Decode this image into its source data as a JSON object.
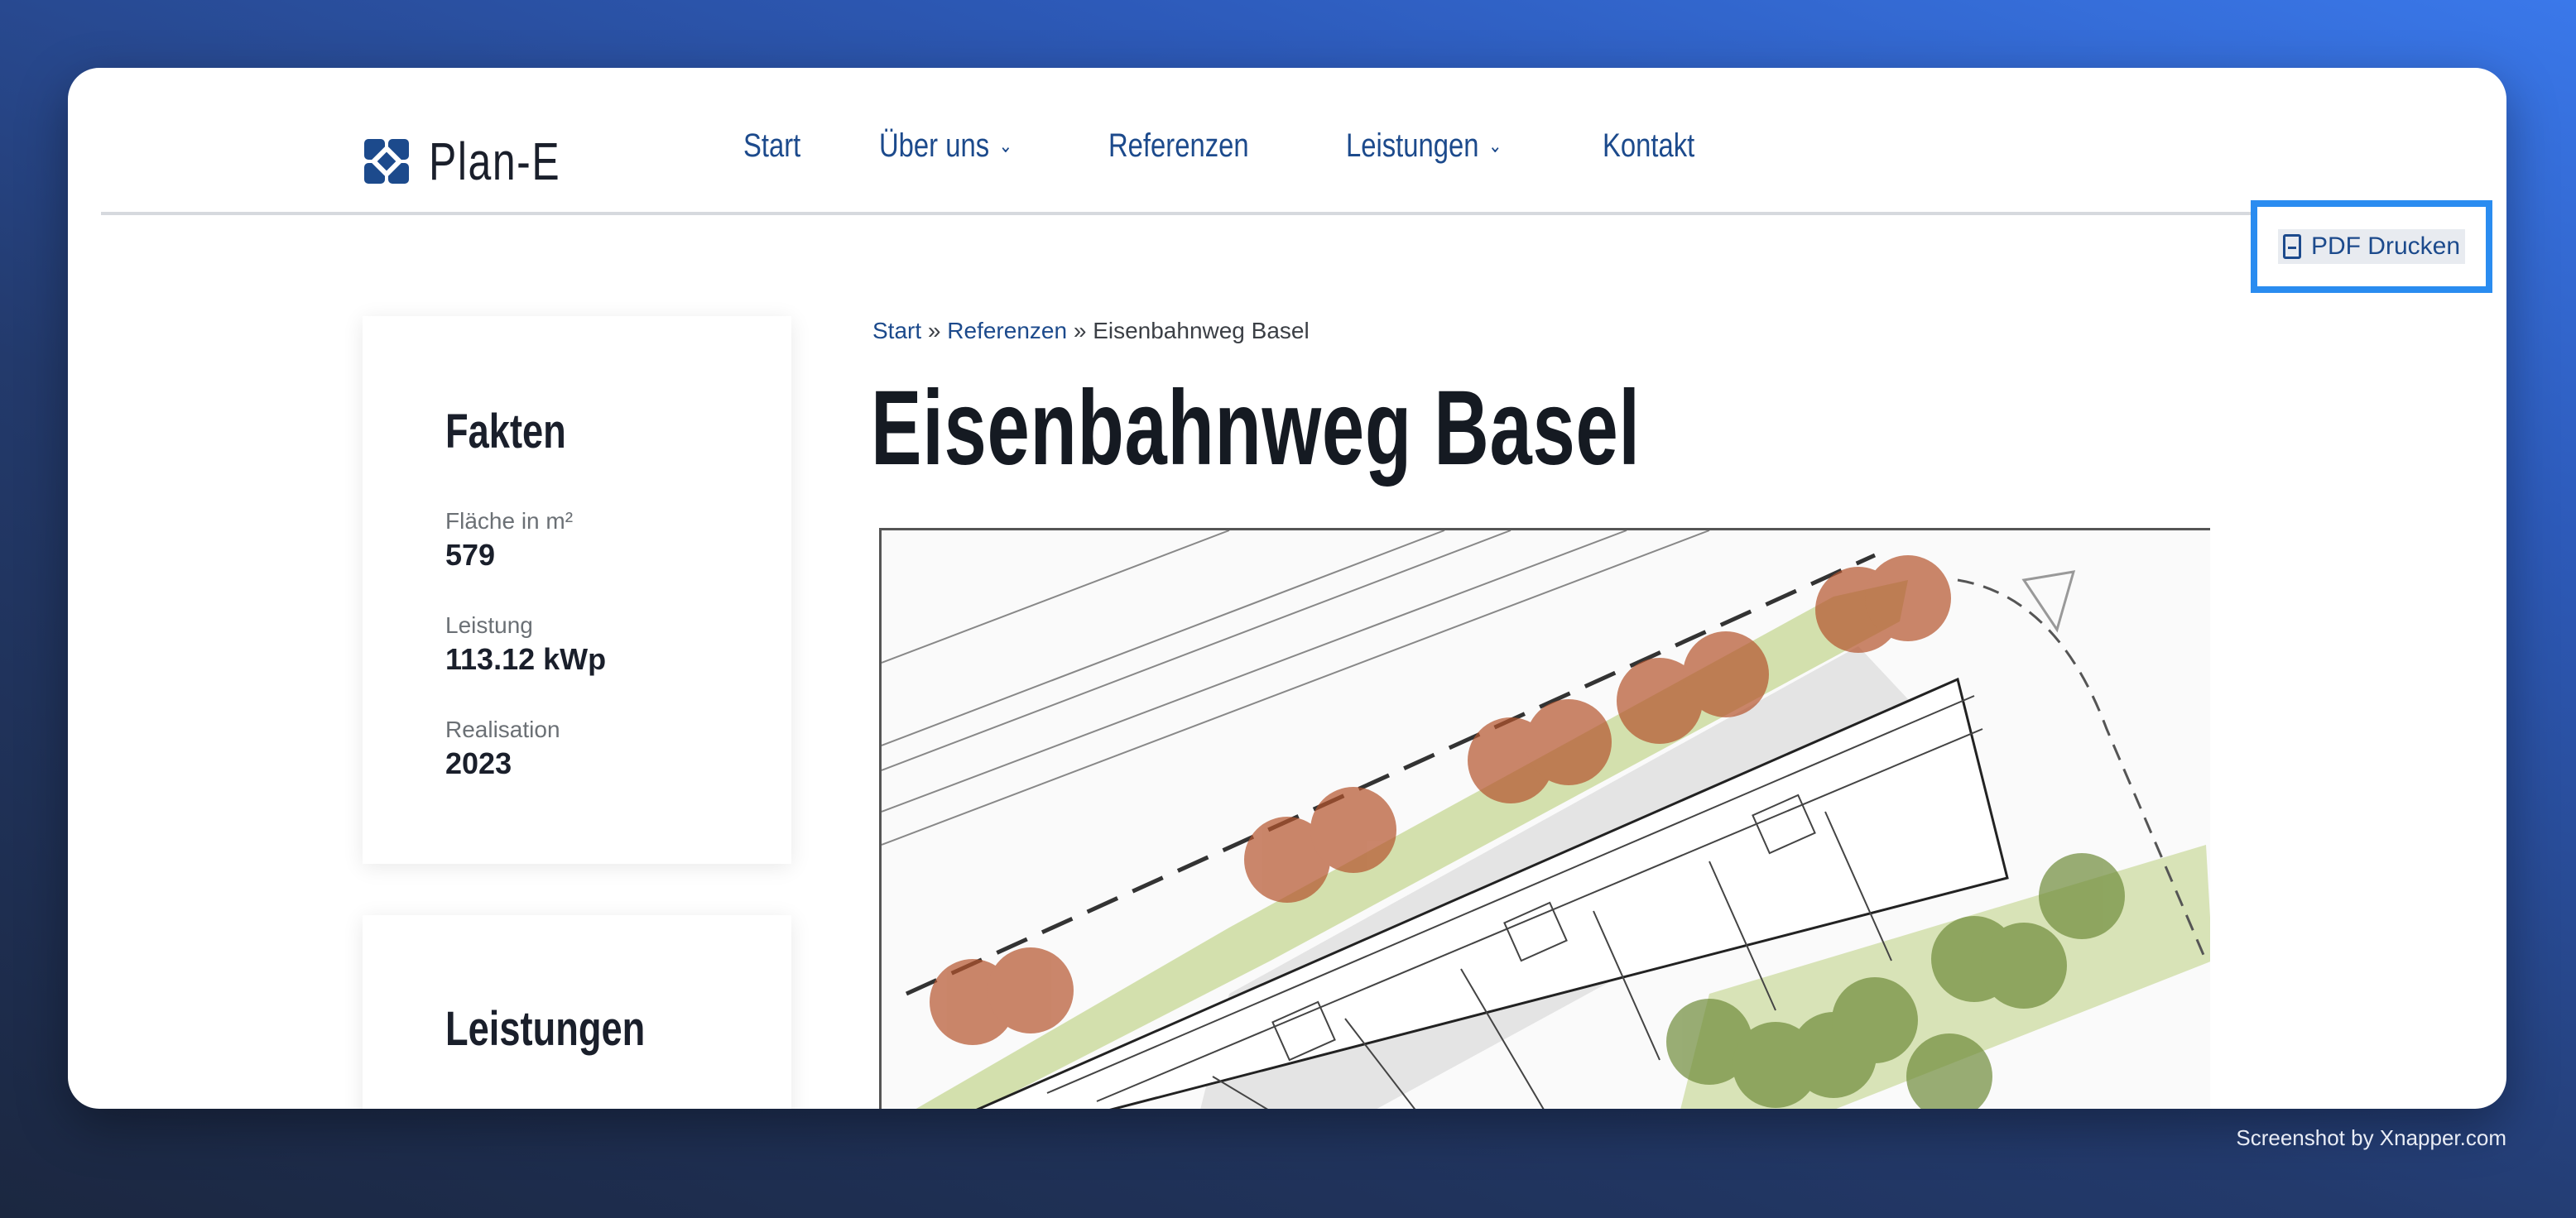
{
  "brand": {
    "name": "Plan-E"
  },
  "nav": {
    "items": [
      {
        "label": "Start",
        "has_dropdown": false
      },
      {
        "label": "Über uns",
        "has_dropdown": true
      },
      {
        "label": "Referenzen",
        "has_dropdown": false
      },
      {
        "label": "Leistungen",
        "has_dropdown": true
      },
      {
        "label": "Kontakt",
        "has_dropdown": false
      }
    ]
  },
  "toolbar": {
    "pdf_label": "PDF Drucken",
    "pdf_icon": "pdf-file-icon"
  },
  "breadcrumb": {
    "home": "Start",
    "section": "Referenzen",
    "current": "Eisenbahnweg Basel",
    "separator": "»"
  },
  "page": {
    "title": "Eisenbahnweg Basel"
  },
  "facts": {
    "title": "Fakten",
    "items": [
      {
        "label": "Fläche in m²",
        "value": "579"
      },
      {
        "label": "Leistung",
        "value": "113.12 kWp"
      },
      {
        "label": "Realisation",
        "value": "2023"
      }
    ]
  },
  "services": {
    "title": "Leistungen"
  },
  "footer": {
    "credit": "Screenshot by Xnapper.com"
  },
  "colors": {
    "brand": "#1c4a8c",
    "highlight": "#2a8cf0",
    "title": "#151a22"
  }
}
